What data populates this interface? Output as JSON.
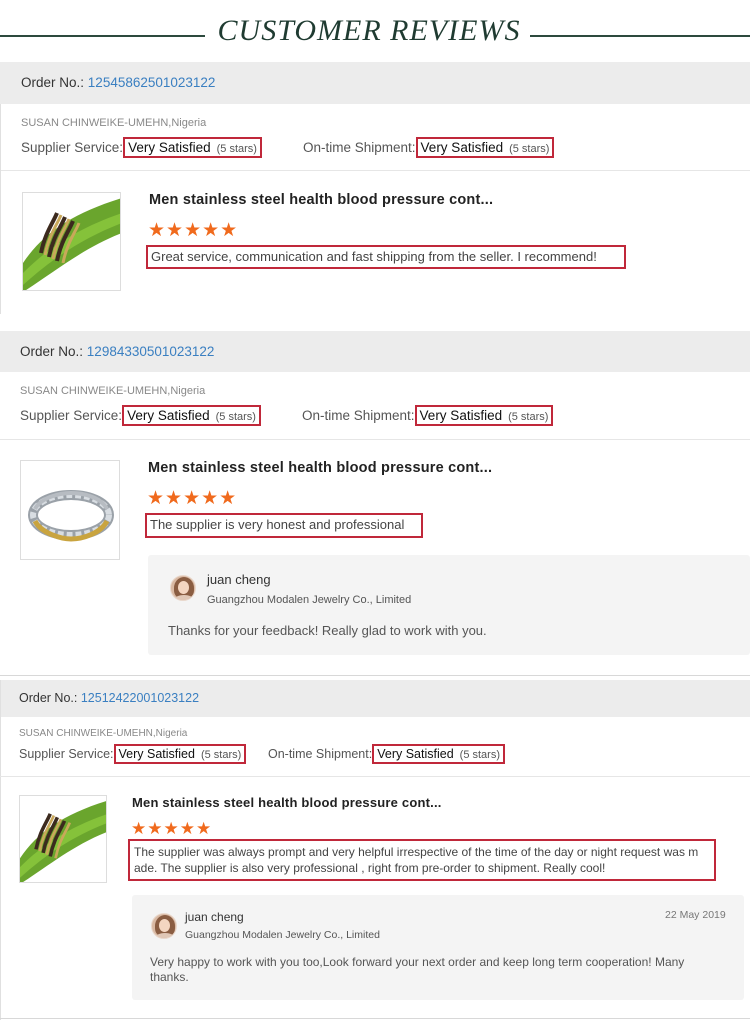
{
  "header": {
    "title": "CUSTOMER REVIEWS"
  },
  "colors": {
    "accent_orange": "#f06a1d",
    "highlight_red": "#c0283a",
    "order_link": "#3a7fc1",
    "banner_green": "#1f3b31"
  },
  "order_label": "Order No.:",
  "supplier_label": "Supplier Service:",
  "shipment_label": "On-time Shipment:",
  "reviews": [
    {
      "order_no": "12545862501023122",
      "buyer": "SUSAN CHINWEIKE-UMEHN,Nigeria",
      "supplier_rating": "Very Satisfied",
      "supplier_stars": "(5 stars)",
      "shipment_rating": "Very Satisfied",
      "shipment_stars": "(5 stars)",
      "product_title": "Men stainless steel health blood pressure cont...",
      "stars": "★★★★★",
      "star_count": 5,
      "comment": "Great service, communication and fast shipping from the seller. I recommend!",
      "thumb_icon": "green-bracelet-photo"
    },
    {
      "order_no": "12984330501023122",
      "buyer": "SUSAN CHINWEIKE-UMEHN,Nigeria",
      "supplier_rating": "Very Satisfied",
      "supplier_stars": "(5 stars)",
      "shipment_rating": "Very Satisfied",
      "shipment_stars": "(5 stars)",
      "product_title": "Men stainless steel health blood pressure cont...",
      "stars": "★★★★★",
      "star_count": 5,
      "comment": "The supplier is very honest and professional",
      "thumb_icon": "silver-bracelet-photo",
      "reply": {
        "name": "juan cheng",
        "company": "Guangzhou Modalen Jewelry Co., Limited",
        "text": "Thanks for your feedback! Really glad to work with you."
      }
    },
    {
      "order_no": "12512422001023122",
      "buyer": "SUSAN CHINWEIKE-UMEHN,Nigeria",
      "supplier_rating": "Very Satisfied",
      "supplier_stars": "(5 stars)",
      "shipment_rating": "Very Satisfied",
      "shipment_stars": "(5 stars)",
      "product_title": "Men stainless steel health blood pressure cont...",
      "stars": "★★★★★",
      "star_count": 5,
      "comment_line1": "The supplier was always prompt and very helpful irrespective of the time of the day or night request was m",
      "comment_line2": "ade. The supplier is also very professional , right from pre-order to shipment. Really cool!",
      "thumb_icon": "green-bracelet-photo",
      "reply": {
        "name": "juan cheng",
        "company": "Guangzhou Modalen Jewelry Co., Limited",
        "date": "22 May 2019",
        "text_line1": "Very happy to work with you too,Look forward your next order and keep long term cooperation! Many",
        "text_line2": "thanks."
      }
    }
  ]
}
